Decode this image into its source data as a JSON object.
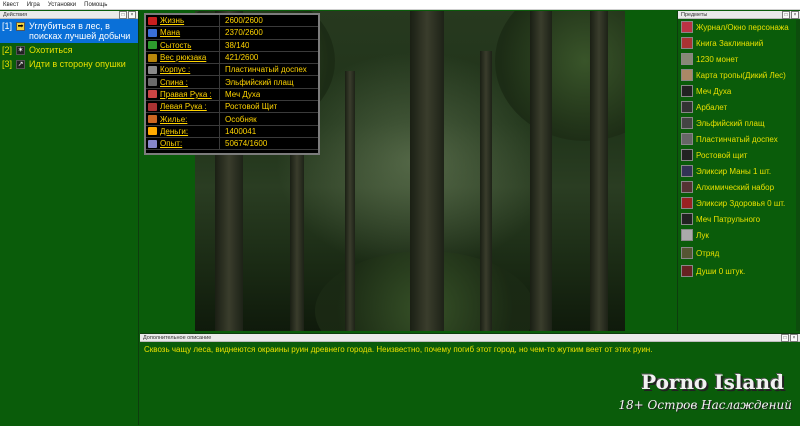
{
  "menubar": {
    "items": [
      "Квест",
      "Игра",
      "Установки",
      "Помощь"
    ]
  },
  "actions_panel": {
    "title": "Действия",
    "items": [
      {
        "num": "[1]",
        "label": "Углубиться в лес, в поисках лучшей добычи",
        "selected": true
      },
      {
        "num": "[2]",
        "label": "Охотиться"
      },
      {
        "num": "[3]",
        "label": "Идти в сторону опушки"
      }
    ]
  },
  "stats": {
    "rows": [
      {
        "label": "Жизнь",
        "value": "2600/2600",
        "color": "#c81e1e"
      },
      {
        "label": "Мана",
        "value": "2370/2600",
        "color": "#3a6fd8"
      },
      {
        "label": "Сытость",
        "value": "38/140",
        "color": "#2e9a2e"
      },
      {
        "label": "Вес рюкзака",
        "value": "421/2600",
        "color": "#b8860b"
      },
      {
        "label": "Корпус :",
        "value": "Пластинчатый доспех",
        "color": "#8a8a8a"
      },
      {
        "label": "Спина :",
        "value": "Эльфийский плащ",
        "color": "#6a6a6a"
      },
      {
        "label": "Правая Рука :",
        "value": "Меч Духа",
        "color": "#cc4444"
      },
      {
        "label": "Левая Рука :",
        "value": "Ростовой Щит",
        "color": "#aa3333"
      },
      {
        "label": "Жилье:",
        "value": "Особняк",
        "color": "#cc6622"
      },
      {
        "label": "Деньги:",
        "value": "1400041",
        "color": "#ffaa00"
      },
      {
        "label": "Опыт:",
        "value": "50674/1600",
        "color": "#8888cc"
      }
    ]
  },
  "items_panel": {
    "title": "Предметы",
    "items": [
      {
        "label": "Журнал/Окно персонажа",
        "icon": "journal-icon"
      },
      {
        "label": "Книга Заклинаний",
        "icon": "spellbook-icon"
      },
      {
        "label": "1230 монет",
        "icon": "coins-icon"
      },
      {
        "label": "Карта тропы(Дикий Лес)",
        "icon": "map-icon"
      },
      {
        "label": "Меч Духа",
        "icon": "sword-icon"
      },
      {
        "label": "Арбалет",
        "icon": "crossbow-icon"
      },
      {
        "label": "Эльфийский плащ",
        "icon": "cloak-icon"
      },
      {
        "label": "Пластинчатый доспех",
        "icon": "armor-icon"
      },
      {
        "label": "Ростовой щит",
        "icon": "shield-icon"
      },
      {
        "label": "Эликсир Маны 1 шт.",
        "icon": "mana-potion-icon"
      },
      {
        "label": "Алхимический набор",
        "icon": "alchemy-kit-icon"
      },
      {
        "label": "Эликсир Здоровья 0 шт.",
        "icon": "health-potion-icon"
      },
      {
        "label": "Меч Патрульного",
        "icon": "sword-icon"
      },
      {
        "label": "Лук",
        "icon": "bow-icon"
      },
      {
        "label": "Отряд",
        "icon": "squad-icon"
      },
      {
        "label": "Души 0 штук.",
        "icon": "souls-icon"
      }
    ]
  },
  "description_panel": {
    "title": "Дополнительное описание",
    "text": "Сквозь чащу леса, виднеются окраины руин древнего города. Неизвестно, почему погиб этот город, но чем-то жутким веет от этих руин."
  },
  "logo": {
    "line1": "Porno Island",
    "line2": "18+ Остров Наслаждений"
  },
  "colors": {
    "panel_bg": "#0a5c0a",
    "text_yellow": "#e8e000",
    "selected_bg": "#0a70d8"
  }
}
